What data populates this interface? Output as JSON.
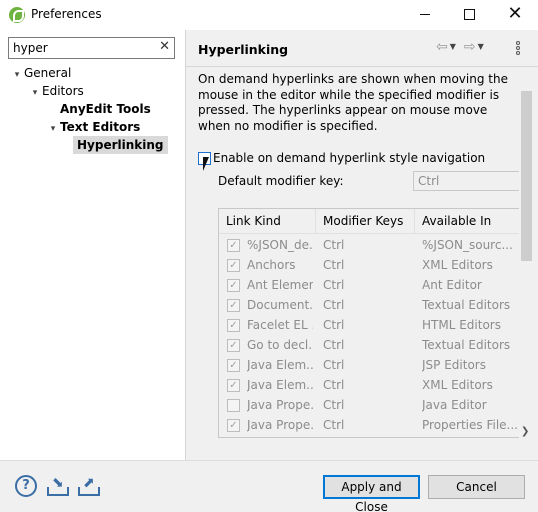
{
  "window": {
    "title": "Preferences",
    "minimize_icon": "minimize-icon",
    "maximize_icon": "maximize-icon",
    "close_glyph": "✕"
  },
  "filter": {
    "value": "hyper",
    "clear_glyph": "✕"
  },
  "tree": {
    "items": [
      {
        "label": "General",
        "level": 0,
        "expanded": true,
        "bold": false,
        "selected": false
      },
      {
        "label": "Editors",
        "level": 1,
        "expanded": true,
        "bold": false,
        "selected": false
      },
      {
        "label": "AnyEdit Tools",
        "level": 2,
        "expanded": false,
        "bold": true,
        "selected": false
      },
      {
        "label": "Text Editors",
        "level": 2,
        "expanded": true,
        "bold": true,
        "selected": false
      },
      {
        "label": "Hyperlinking",
        "level": 3,
        "expanded": false,
        "bold": true,
        "selected": true
      }
    ]
  },
  "page": {
    "title": "Hyperlinking",
    "description": "On demand hyperlinks are shown when moving the mouse in the editor while the specified modifier is pressed. The hyperlinks appear on mouse move when no modifier is specified.",
    "enable_label": "Enable on demand hyperlink style navigation",
    "enable_checked": false,
    "modifier_label": "Default modifier key:",
    "modifier_value": "Ctrl"
  },
  "table": {
    "headers": [
      "Link Kind",
      "Modifier Keys",
      "Available In"
    ],
    "rows": [
      {
        "checked": true,
        "kind": "%JSON_de...",
        "mod": "Ctrl",
        "avail": "%JSON_sourc..."
      },
      {
        "checked": true,
        "kind": "Anchors",
        "mod": "Ctrl",
        "avail": "XML Editors"
      },
      {
        "checked": true,
        "kind": "Ant Element",
        "mod": "Ctrl",
        "avail": "Ant Editor"
      },
      {
        "checked": true,
        "kind": "Document...",
        "mod": "Ctrl",
        "avail": "Textual Editors"
      },
      {
        "checked": true,
        "kind": "Facelet EL ...",
        "mod": "Ctrl",
        "avail": "HTML Editors"
      },
      {
        "checked": true,
        "kind": "Go to decl...",
        "mod": "Ctrl",
        "avail": "Textual Editors"
      },
      {
        "checked": true,
        "kind": "Java Elem...",
        "mod": "Ctrl",
        "avail": "JSP Editors"
      },
      {
        "checked": true,
        "kind": "Java Elem...",
        "mod": "Ctrl",
        "avail": "XML Editors"
      },
      {
        "checked": false,
        "kind": "Java Prope...",
        "mod": "Ctrl",
        "avail": "Java Editor"
      },
      {
        "checked": true,
        "kind": "Java Prope...",
        "mod": "Ctrl",
        "avail": "Properties File..."
      }
    ]
  },
  "buttons": {
    "apply_close": "Apply and Close",
    "cancel": "Cancel"
  },
  "colors": {
    "accent": "#0078d7",
    "icon_blue": "#3a6ea5",
    "panel_bg": "#f0f0f0"
  }
}
